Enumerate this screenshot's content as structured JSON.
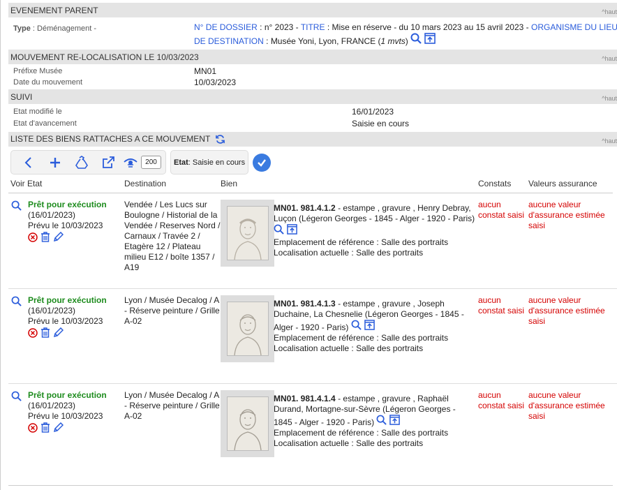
{
  "event": {
    "header": "EVENEMENT PARENT",
    "haut": "^haut",
    "type_label": "Type",
    "type_value": "Déménagement -",
    "dossier_label": "N° DE DOSSIER",
    "dossier_value": "n° 2023 -",
    "titre_label": "TITRE",
    "titre_value": "Mise en réserve - du 10 mars 2023 au 15 avril 2023 -",
    "org_label_1": "ORGANISME DU LIEU",
    "org_label_2": "DE DESTINATION",
    "org_value": "Musée Yoni, Lyon, FRANCE (",
    "mvts": "1 mvts",
    "mvts_close": ")"
  },
  "movement": {
    "header": "MOUVEMENT RE-LOCALISATION LE 10/03/2023",
    "haut": "^haut",
    "prefix_label": "Préfixe Musée",
    "prefix_value": "MN01",
    "date_label": "Date du mouvement",
    "date_value": "10/03/2023"
  },
  "suivi": {
    "header": "SUIVI",
    "haut": "^haut",
    "modified_label": "Etat modifié le",
    "modified_value": "16/01/2023",
    "progress_label": "Etat d'avancement",
    "progress_value": "Saisie en cours"
  },
  "list": {
    "header": "LISTE DES BIENS RATTACHES A CE MOUVEMENT",
    "haut": "^haut",
    "count": "200",
    "etat_label": "Etat",
    "etat_value": " : Saisie en cours",
    "columns": {
      "voir_etat": "Voir Etat",
      "destination": "Destination",
      "bien": "Bien",
      "constats": "Constats",
      "valeurs": "Valeurs assurance"
    },
    "rows": [
      {
        "status": "Prêt pour exécution",
        "date": "(16/01/2023)",
        "planned": "Prévu le 10/03/2023",
        "destination": "Vendée / Les Lucs sur Boulogne / Historial de la Vendée / Reserves Nord / Carnaux / Travée 2 / Etagère 12 / Plateau milieu E12 / boîte 1357 / A19",
        "id": "MN01. 981.4.1.2",
        "desc": " - estampe , gravure , Henry Debray, Luçon (Légeron Georges - 1845 - Alger - 1920 - Paris)",
        "ref_loc": "Emplacement de référence : Salle des portraits",
        "cur_loc": "Localisation actuelle : Salle des portraits",
        "constat": "aucun constat saisi",
        "valeur": "aucune valeur d'assurance estimée saisi"
      },
      {
        "status": "Prêt pour exécution",
        "date": "(16/01/2023)",
        "planned": "Prévu le 10/03/2023",
        "destination": "Lyon / Musée Decalog / A - Réserve peinture / Grille A-02",
        "id": "MN01. 981.4.1.3",
        "desc": " - estampe , gravure , Joseph Duchaine, La Chesnelie (Légeron Georges - 1845 - Alger - 1920 - Paris)",
        "ref_loc": "Emplacement de référence : Salle des portraits",
        "cur_loc": "Localisation actuelle : Salle des portraits",
        "constat": "aucun constat saisi",
        "valeur": "aucune valeur d'assurance estimée saisi"
      },
      {
        "status": "Prêt pour exécution",
        "date": "(16/01/2023)",
        "planned": "Prévu le 10/03/2023",
        "destination": "Lyon / Musée Decalog / A - Réserve peinture / Grille A-02",
        "id": "MN01. 981.4.1.4",
        "desc": " - estampe , gravure , Raphaël Durand, Mortagne-sur-Sèvre (Légeron Georges - 1845 - Alger - 1920 - Paris)",
        "ref_loc": "Emplacement de référence : Salle des portraits",
        "cur_loc": "Localisation actuelle : Salle des portraits",
        "constat": "aucun constat saisi",
        "valeur": "aucune valeur d'assurance estimée saisi"
      }
    ]
  },
  "colors": {
    "accent": "#2a5cdb",
    "ready": "#1e8c1e",
    "warning": "#d40000",
    "header_bg": "#e4e4e4"
  }
}
